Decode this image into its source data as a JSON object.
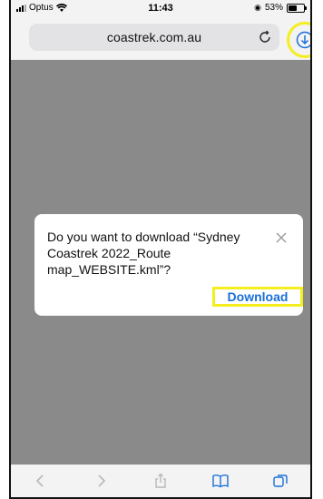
{
  "status_bar": {
    "carrier": "Optus",
    "time": "11:43",
    "battery": "53%"
  },
  "browser": {
    "url": "coastrek.com.au"
  },
  "dialog": {
    "message": "Do you want to download “Sydney Coastrek 2022_Route map_WEBSITE.kml”?",
    "download_label": "Download"
  },
  "colors": {
    "highlight": "#f5ee1e",
    "link_blue": "#1a6fd8",
    "overlay_gray": "#8a8a8a"
  },
  "icons": {
    "reload": "reload-icon",
    "download": "download-circle-icon",
    "close": "close-icon",
    "back": "chevron-left-icon",
    "forward": "chevron-right-icon",
    "share": "share-icon",
    "bookmarks": "book-icon",
    "tabs": "tabs-icon"
  }
}
